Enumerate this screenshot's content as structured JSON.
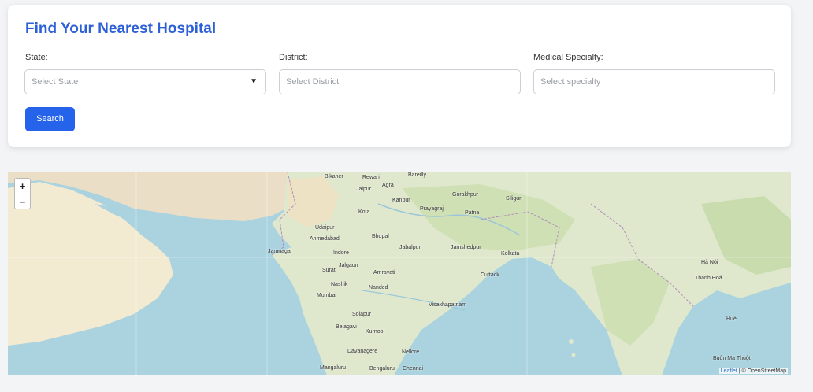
{
  "form": {
    "title": "Find Your Nearest Hospital",
    "state_label": "State:",
    "state_placeholder": "Select State",
    "district_label": "District:",
    "district_placeholder": "Select District",
    "specialty_label": "Medical Specialty:",
    "specialty_placeholder": "Select specialty",
    "search_label": "Search",
    "caret": "▼"
  },
  "map": {
    "zoom_in": "+",
    "zoom_out": "−",
    "attribution_leaflet": "Leaflet",
    "attribution_sep": " | © ",
    "attribution_osm": "OpenStreetMap",
    "cities": [
      "Bikaner",
      "Rewari",
      "Bareilly",
      "Agra",
      "Jaipur",
      "Kanpur",
      "Gorakhpur",
      "Siliguri",
      "Prayagraj",
      "Patna",
      "Kota",
      "Udaipur",
      "Ahmedabad",
      "Bhopal",
      "Jabalpur",
      "Jamshedpur",
      "Kolkata",
      "Jamnagar",
      "Indore",
      "Surat",
      "Jalgaon",
      "Amravati",
      "Cuttack",
      "Nashik",
      "Nanded",
      "Mumbai",
      "Visakhapatnam",
      "Solapur",
      "Belagavi",
      "Kurnool",
      "Davanagere",
      "Nellore",
      "Mangaluru",
      "Bengaluru",
      "Chennai",
      "Hà Nội",
      "Thanh Hoá",
      "Huế",
      "Buôn Ma Thuột"
    ]
  }
}
